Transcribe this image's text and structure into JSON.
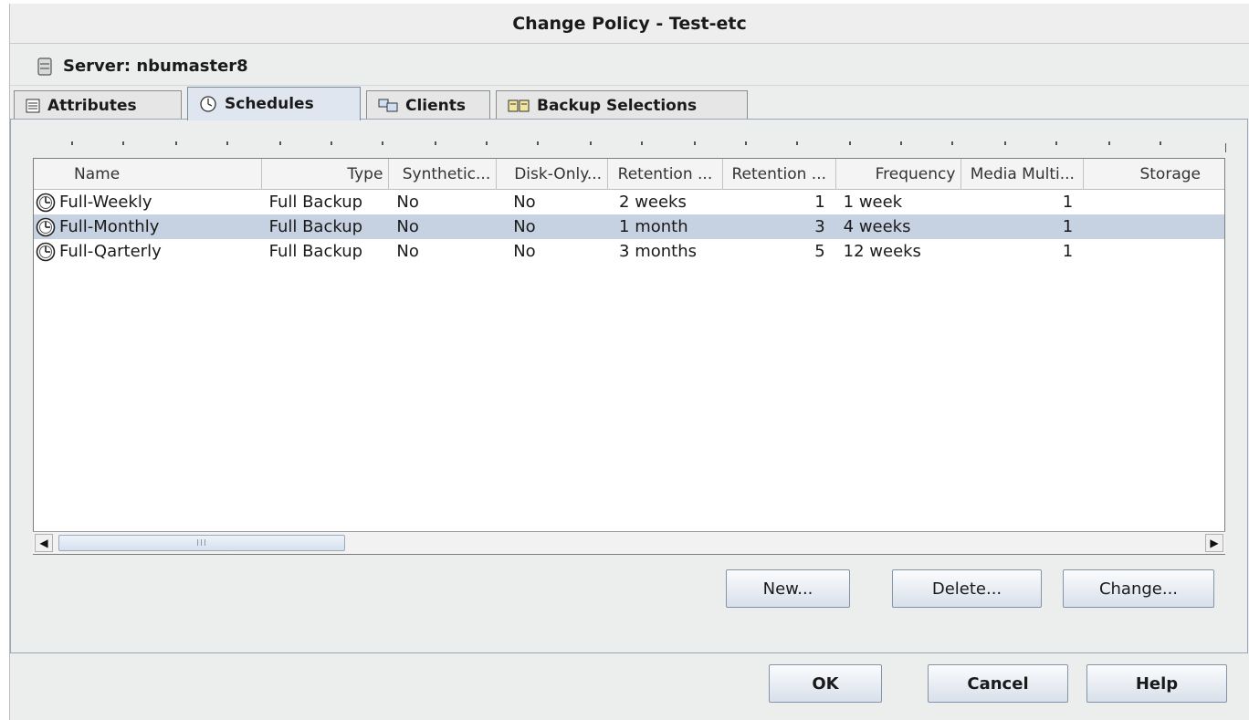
{
  "window": {
    "title": "Change Policy - Test-etc"
  },
  "server": {
    "label": "Server: nbumaster8"
  },
  "tabs": [
    {
      "label": "Attributes"
    },
    {
      "label": "Schedules"
    },
    {
      "label": "Clients"
    },
    {
      "label": "Backup Selections"
    }
  ],
  "active_tab": "Schedules",
  "table": {
    "columns": [
      "Name",
      "Type",
      "Synthetic...",
      "Disk-Only...",
      "Retention ...",
      "Retention ...",
      "Frequency",
      "Media Multi...",
      "Storage"
    ],
    "rows": [
      {
        "name": "Full-Weekly",
        "type": "Full Backup",
        "synthetic": "No",
        "disk_only": "No",
        "retention": "2 weeks",
        "retention_level": "1",
        "frequency": "1 week",
        "media_multi": "1",
        "storage": ""
      },
      {
        "name": "Full-Monthly",
        "type": "Full Backup",
        "synthetic": "No",
        "disk_only": "No",
        "retention": "1 month",
        "retention_level": "3",
        "frequency": "4 weeks",
        "media_multi": "1",
        "storage": ""
      },
      {
        "name": "Full-Qarterly",
        "type": "Full Backup",
        "synthetic": "No",
        "disk_only": "No",
        "retention": "3 months",
        "retention_level": "5",
        "frequency": "12 weeks",
        "media_multi": "1",
        "storage": ""
      }
    ],
    "selected_row": 1
  },
  "scrollbar": {
    "left_arrow": "◀",
    "right_arrow": "▶",
    "thumb_grip": "III"
  },
  "schedule_buttons": {
    "new": "New...",
    "delete": "Delete...",
    "change": "Change..."
  },
  "dialog_buttons": {
    "ok": "OK",
    "cancel": "Cancel",
    "help": "Help"
  },
  "icons": {
    "server": "server-icon",
    "attributes": "attributes-icon",
    "schedules": "schedules-icon",
    "clients": "clients-icon",
    "backup_selections": "backup-selections-icon",
    "schedule_row": "clock-icon"
  },
  "colors": {
    "selected_row": "#c6d2e2",
    "active_tab": "#dfe6f0",
    "panel_border": "#9aa6b6"
  }
}
